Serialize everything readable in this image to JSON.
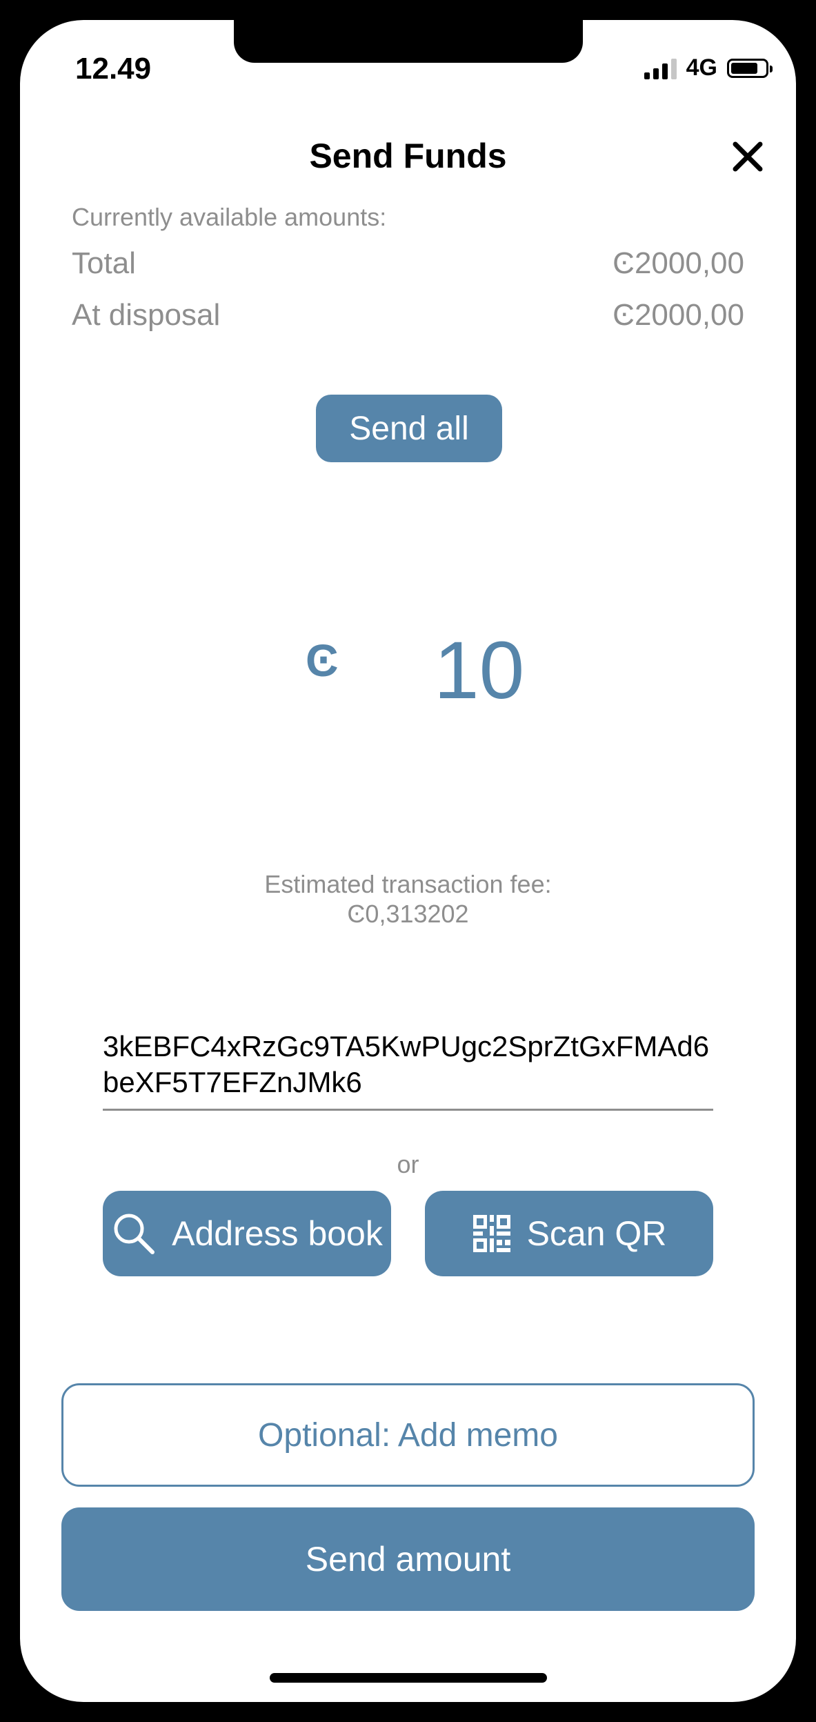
{
  "status_bar": {
    "time": "12.49",
    "network": "4G",
    "signal_bars": 4,
    "battery_level": 0.8
  },
  "header": {
    "title": "Send Funds",
    "close_icon": "close-icon"
  },
  "balances": {
    "label": "Currently available amounts:",
    "total_label": "Total",
    "total_value": "Ͼ2000,00",
    "disposal_label": "At disposal",
    "disposal_value": "Ͼ2000,00"
  },
  "send_all_label": "Send all",
  "amount": {
    "currency_symbol": "Ͼ",
    "value": "10"
  },
  "fee": {
    "label": "Estimated transaction fee:",
    "value": "Ͼ0,313202"
  },
  "recipient": {
    "address": "3kEBFC4xRzGc9TA5KwPUgc2SprZtGxFMAd6beXF5T7EFZnJMk6"
  },
  "or_label": "or",
  "buttons": {
    "address_book": "Address book",
    "scan_qr": "Scan QR",
    "add_memo": "Optional: Add memo",
    "send_amount": "Send amount"
  },
  "colors": {
    "accent": "#5685aa",
    "muted_text": "#8e8e8e"
  }
}
